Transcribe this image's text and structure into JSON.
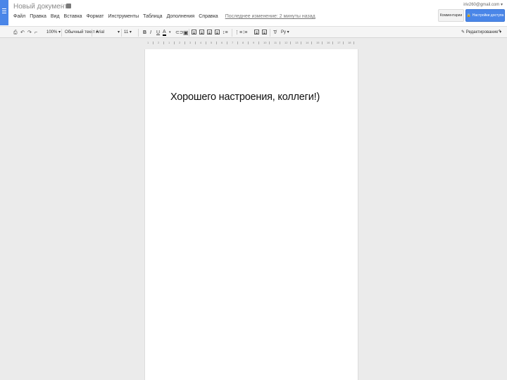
{
  "doc": {
    "title": "Новый документ",
    "body_text": "Хорошего настроения, коллеги!)"
  },
  "menu": {
    "items": [
      "Файл",
      "Правка",
      "Вид",
      "Вставка",
      "Формат",
      "Инструменты",
      "Таблица",
      "Дополнения",
      "Справка"
    ],
    "last_edit": "Последнее изменение: 2 минуты назад"
  },
  "header": {
    "user_email": "iriv260@gmail.com",
    "comments_label": "Комментарии",
    "share_label": "Настройки доступа"
  },
  "toolbar": {
    "zoom": "100%",
    "style": "Обычный текст",
    "font": "Arial",
    "size": "11",
    "input_tools": "Ру",
    "edit_mode": "Редактирование"
  },
  "ruler": [
    "1",
    "2",
    "1",
    "2",
    "3",
    "4",
    "5",
    "6",
    "7",
    "8",
    "9",
    "10",
    "11",
    "12",
    "13",
    "14",
    "15",
    "16",
    "17",
    "18"
  ],
  "colors": {
    "accent": "#4a86e8",
    "page_bg": "#ebebeb"
  }
}
